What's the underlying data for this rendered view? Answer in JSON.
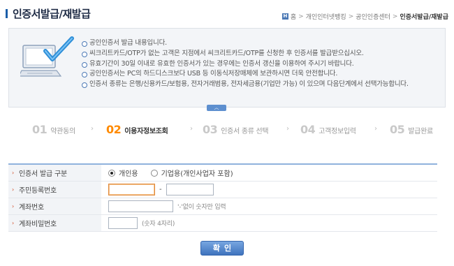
{
  "header": {
    "title": "인증서발급/재발급",
    "breadcrumb": {
      "home_icon_text": "H",
      "items": [
        "홈",
        "개인인터넷뱅킹",
        "공인인증센터"
      ],
      "current": "인증서발급/재발급",
      "separator": ">"
    }
  },
  "info": {
    "illustration": "computer-with-checkmark",
    "notes": [
      "공인인증서 발급 내용입니다.",
      "씨크리트카드/OTP가 없는 고객은 지점에서 씨크리트카드/OTP를 신청한 후 인증서를 발급받으십시오.",
      "유효기간이 30일 이내로 유효한 인증서가 있는 경우에는 인증서 갱신을 이용하여 주시기 바랍니다.",
      "공인인증서는 PC의 하드디스크보다 USB 등 이동식저장매체에 보관하시면 더욱 안전합니다.",
      "인증서 종류는 은행/신용카드/보험용, 전자거래범용, 전자세금용(기업만 가능) 이 있으며 다음단계에서 선택가능합니다."
    ],
    "collapse_glyph": "︿"
  },
  "steps": [
    {
      "num": "01",
      "label": "약관동의",
      "active": false
    },
    {
      "num": "02",
      "label": "이용자정보조회",
      "active": true
    },
    {
      "num": "03",
      "label": "인증서 종류 선택",
      "active": false
    },
    {
      "num": "04",
      "label": "고객정보입력",
      "active": false
    },
    {
      "num": "05",
      "label": "발급완료",
      "active": false
    }
  ],
  "step_arrow": "›",
  "form": {
    "row_arrow": "›",
    "cert_type": {
      "label": "인증서 발급 구분",
      "options": [
        "개인용",
        "기업용(개인사업자 포함)"
      ],
      "selected": "개인용"
    },
    "resident_no": {
      "label": "주민등록번호",
      "part1_value": "",
      "dash": "-",
      "part2_value": ""
    },
    "account_no": {
      "label": "계좌번호",
      "value": "",
      "hint": "'-'없이 숫자만 입력"
    },
    "account_pw": {
      "label": "계좌비밀번호",
      "value": "",
      "hint": "(숫자 4자리)"
    }
  },
  "actions": {
    "confirm_label": "확인"
  },
  "colors": {
    "accent_blue": "#1b5ea8",
    "active_step": "#ff8a00",
    "button_blue": "#3f73bd",
    "label_bg": "#f2f4f7",
    "row_arrow": "#d24a22"
  }
}
